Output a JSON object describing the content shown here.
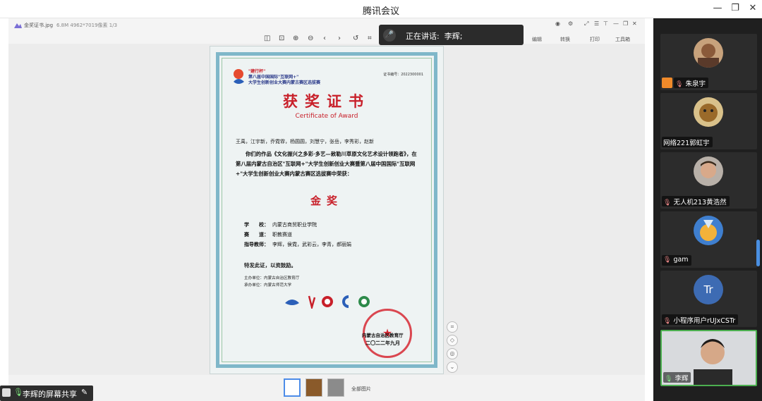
{
  "window": {
    "title": "腾讯会议",
    "minimize": "—",
    "restore": "❐",
    "close": "✕"
  },
  "viewer": {
    "file_name": "金奖证书.jpg",
    "file_meta": "6.8M  4962*7019像素   1/3",
    "tools_right": [
      "编辑",
      "转换",
      "打印",
      "工具箱"
    ]
  },
  "speaking": {
    "label": "正在讲话:",
    "name": "李辉;"
  },
  "certificate": {
    "competition": [
      "\"建行杯\"",
      "第八届中国国际\"互联网+\"",
      "大学生创新创业大赛内蒙古赛区选拔赛"
    ],
    "serial": "证书编号：2022300001",
    "title": "获奖证书",
    "title_en": "Certificate of Award",
    "names": "王禹，江宇新，乔霓霏，杨圆圆，刘慧宁，张岳，李秀彩，赵新",
    "body": "你们的作品《文化振兴之多彩·多艺—敕勒川草原文化艺术设计领跑者》，在第八届内蒙古自治区\"互联网+\"大学生创新创业大赛暨第八届中国国际\"互联网+\"大学生创新创业大赛内蒙古赛区选拔赛中荣获：",
    "award": "金奖",
    "school_label": "学　　校：",
    "school": "内蒙古商贸职业学院",
    "track_label": "赛　　道：",
    "track": "职教赛道",
    "advisor_label": "指导教师：",
    "advisors": "李辉，侯霓，武彩云，李青，郝丽娟",
    "certify": "特发此证，以资鼓励。",
    "host": "主办单位：内蒙古自治区教育厅",
    "organizer": "承办单位：内蒙古师范大学",
    "seal_text": "内蒙古自治区教育厅",
    "date": "二〇二二年九月"
  },
  "thumbs": {
    "all_label": "全部图片"
  },
  "share_label": {
    "text": "李辉的屏幕共享"
  },
  "participants": [
    {
      "name": "朱泉宇",
      "host": true
    },
    {
      "name": "网络221郭虹宇",
      "host": false
    },
    {
      "name": "无人机213黄浩然",
      "host": false
    },
    {
      "name": "gam",
      "host": false
    },
    {
      "name": "小程序用户rUJxCSTr",
      "initials": "Tr",
      "host": false
    },
    {
      "name": "李辉",
      "host": false,
      "active": true
    }
  ],
  "colors": {
    "accent": "#4caf50",
    "cert_red": "#c8202a",
    "panel_bg": "#1f1f1f"
  }
}
